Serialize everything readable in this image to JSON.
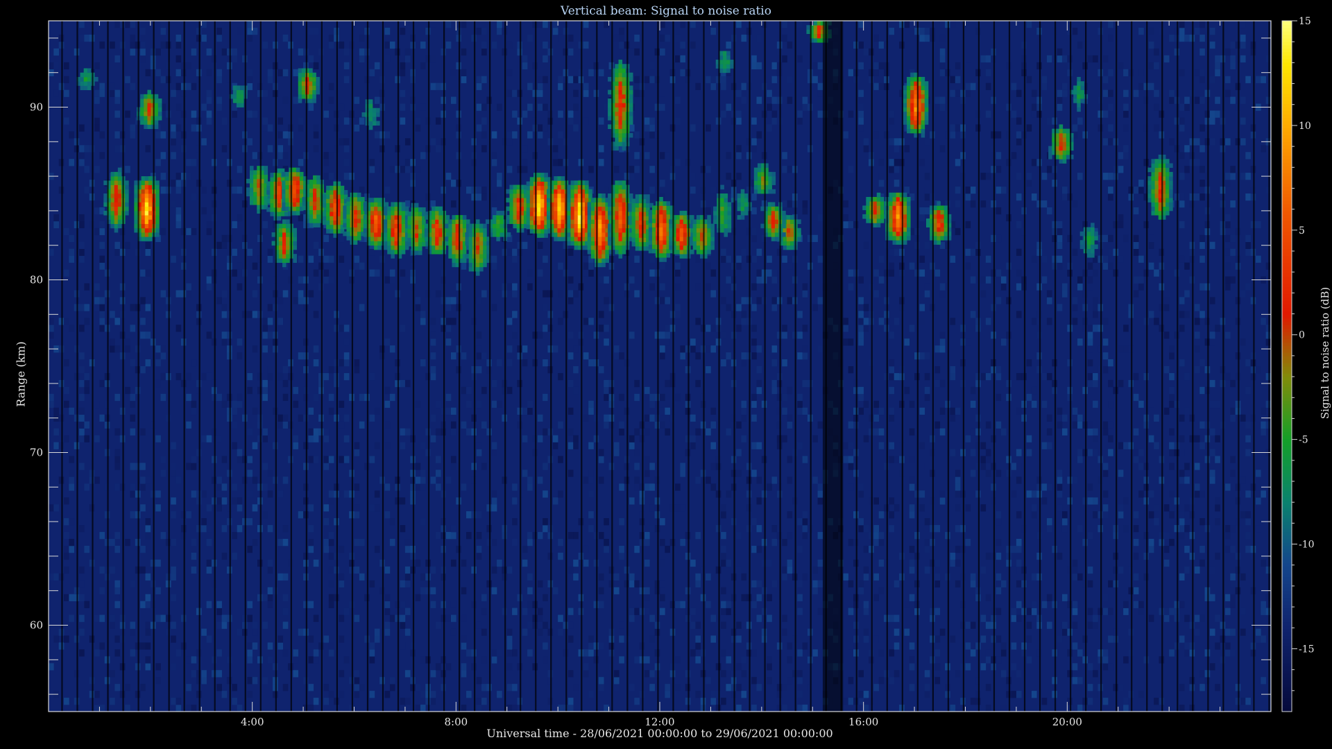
{
  "chart_data": {
    "type": "heatmap",
    "title": "Vertical beam: Signal to noise ratio",
    "xlabel": "Universal time - 28/06/2021 00:00:00 to 29/06/2021 00:00:00",
    "ylabel": "Range (km)",
    "colorbar_label": "Signal to noise ratio (dB)",
    "xlim": [
      0,
      24
    ],
    "ylim": [
      55,
      95
    ],
    "x_ticks": [
      4,
      8,
      12,
      16,
      20
    ],
    "x_tick_labels": [
      "4:00",
      "8:00",
      "12:00",
      "16:00",
      "20:00"
    ],
    "y_ticks": [
      60,
      70,
      80,
      90
    ],
    "y_tick_labels": [
      "60",
      "70",
      "80",
      "90"
    ],
    "colorbar_range": [
      -18,
      15
    ],
    "colorbar_ticks": [
      -15,
      -10,
      -5,
      0,
      5,
      10,
      15
    ],
    "colorbar_tick_labels": [
      "-15",
      "-10",
      "-5",
      "0",
      "5",
      "10",
      "15"
    ],
    "colormap": [
      "#000000",
      "#0b1b5c",
      "#1a3a80",
      "#0a7a6a",
      "#1aa020",
      "#c0a000",
      "#e01000",
      "#ff8000",
      "#ffe000",
      "#ffff80"
    ],
    "background_snr": -14,
    "echo_layer": [
      {
        "t": 4.1,
        "low": 83.6,
        "high": 86.8,
        "peak": 0
      },
      {
        "t": 4.5,
        "low": 83.2,
        "high": 86.5,
        "peak": 4
      },
      {
        "t": 4.8,
        "low": 83.5,
        "high": 86.6,
        "peak": 6
      },
      {
        "t": 5.2,
        "low": 82.8,
        "high": 86.2,
        "peak": 2
      },
      {
        "t": 5.6,
        "low": 82.2,
        "high": 85.8,
        "peak": 5
      },
      {
        "t": 6.0,
        "low": 81.8,
        "high": 85.2,
        "peak": 3
      },
      {
        "t": 6.4,
        "low": 81.5,
        "high": 84.8,
        "peak": 7
      },
      {
        "t": 6.8,
        "low": 81.0,
        "high": 84.6,
        "peak": 5
      },
      {
        "t": 7.2,
        "low": 81.2,
        "high": 84.5,
        "peak": 1
      },
      {
        "t": 7.6,
        "low": 81.0,
        "high": 84.3,
        "peak": 4
      },
      {
        "t": 8.0,
        "low": 80.5,
        "high": 84.0,
        "peak": 3
      },
      {
        "t": 8.4,
        "low": 80.0,
        "high": 83.5,
        "peak": 1
      },
      {
        "t": 8.8,
        "low": 82.0,
        "high": 84.0,
        "peak": -3
      },
      {
        "t": 9.2,
        "low": 82.5,
        "high": 85.6,
        "peak": 4
      },
      {
        "t": 9.6,
        "low": 82.2,
        "high": 86.2,
        "peak": 14
      },
      {
        "t": 10.0,
        "low": 82.0,
        "high": 86.0,
        "peak": 13
      },
      {
        "t": 10.4,
        "low": 81.5,
        "high": 85.8,
        "peak": 15
      },
      {
        "t": 10.8,
        "low": 80.5,
        "high": 85.0,
        "peak": 10
      },
      {
        "t": 11.2,
        "low": 81.0,
        "high": 86.0,
        "peak": 6
      },
      {
        "t": 11.6,
        "low": 81.2,
        "high": 85.0,
        "peak": 3
      },
      {
        "t": 12.0,
        "low": 80.8,
        "high": 84.8,
        "peak": 8
      },
      {
        "t": 12.4,
        "low": 81.0,
        "high": 84.0,
        "peak": 6
      },
      {
        "t": 12.8,
        "low": 81.0,
        "high": 83.8,
        "peak": 1
      },
      {
        "t": 13.2,
        "low": 82.0,
        "high": 85.5,
        "peak": -4
      },
      {
        "t": 13.6,
        "low": 83.0,
        "high": 85.5,
        "peak": -6
      },
      {
        "t": 14.0,
        "low": 84.5,
        "high": 86.8,
        "peak": -2
      }
    ],
    "isolated_echoes": [
      {
        "t": 0.7,
        "low": 90.5,
        "high": 92.5,
        "peak": -6
      },
      {
        "t": 1.3,
        "low": 82.5,
        "high": 86.5,
        "peak": 3
      },
      {
        "t": 1.9,
        "low": 82.0,
        "high": 86.0,
        "peak": 14
      },
      {
        "t": 1.95,
        "low": 88.5,
        "high": 91.0,
        "peak": 2
      },
      {
        "t": 3.7,
        "low": 89.5,
        "high": 91.5,
        "peak": -6
      },
      {
        "t": 4.6,
        "low": 80.5,
        "high": 83.5,
        "peak": 2
      },
      {
        "t": 5.05,
        "low": 90.0,
        "high": 92.3,
        "peak": 2
      },
      {
        "t": 6.3,
        "low": 88.2,
        "high": 90.8,
        "peak": -7
      },
      {
        "t": 11.2,
        "low": 87.0,
        "high": 93.0,
        "peak": 3
      },
      {
        "t": 13.25,
        "low": 91.5,
        "high": 93.5,
        "peak": -6
      },
      {
        "t": 15.1,
        "low": 93.5,
        "high": 95.0,
        "peak": 3
      },
      {
        "t": 16.2,
        "low": 82.8,
        "high": 85.0,
        "peak": 2
      },
      {
        "t": 16.65,
        "low": 81.8,
        "high": 85.2,
        "peak": 10
      },
      {
        "t": 17.0,
        "low": 88.0,
        "high": 92.0,
        "peak": 9
      },
      {
        "t": 17.45,
        "low": 81.8,
        "high": 84.5,
        "peak": 4
      },
      {
        "t": 19.85,
        "low": 86.5,
        "high": 89.0,
        "peak": 2
      },
      {
        "t": 20.2,
        "low": 89.5,
        "high": 91.8,
        "peak": -6
      },
      {
        "t": 20.4,
        "low": 80.8,
        "high": 83.5,
        "peak": -6
      },
      {
        "t": 21.8,
        "low": 83.0,
        "high": 87.3,
        "peak": 3
      },
      {
        "t": 14.5,
        "low": 81.5,
        "high": 83.8,
        "peak": 1
      },
      {
        "t": 14.2,
        "low": 82.0,
        "high": 84.5,
        "peak": 2
      }
    ]
  }
}
